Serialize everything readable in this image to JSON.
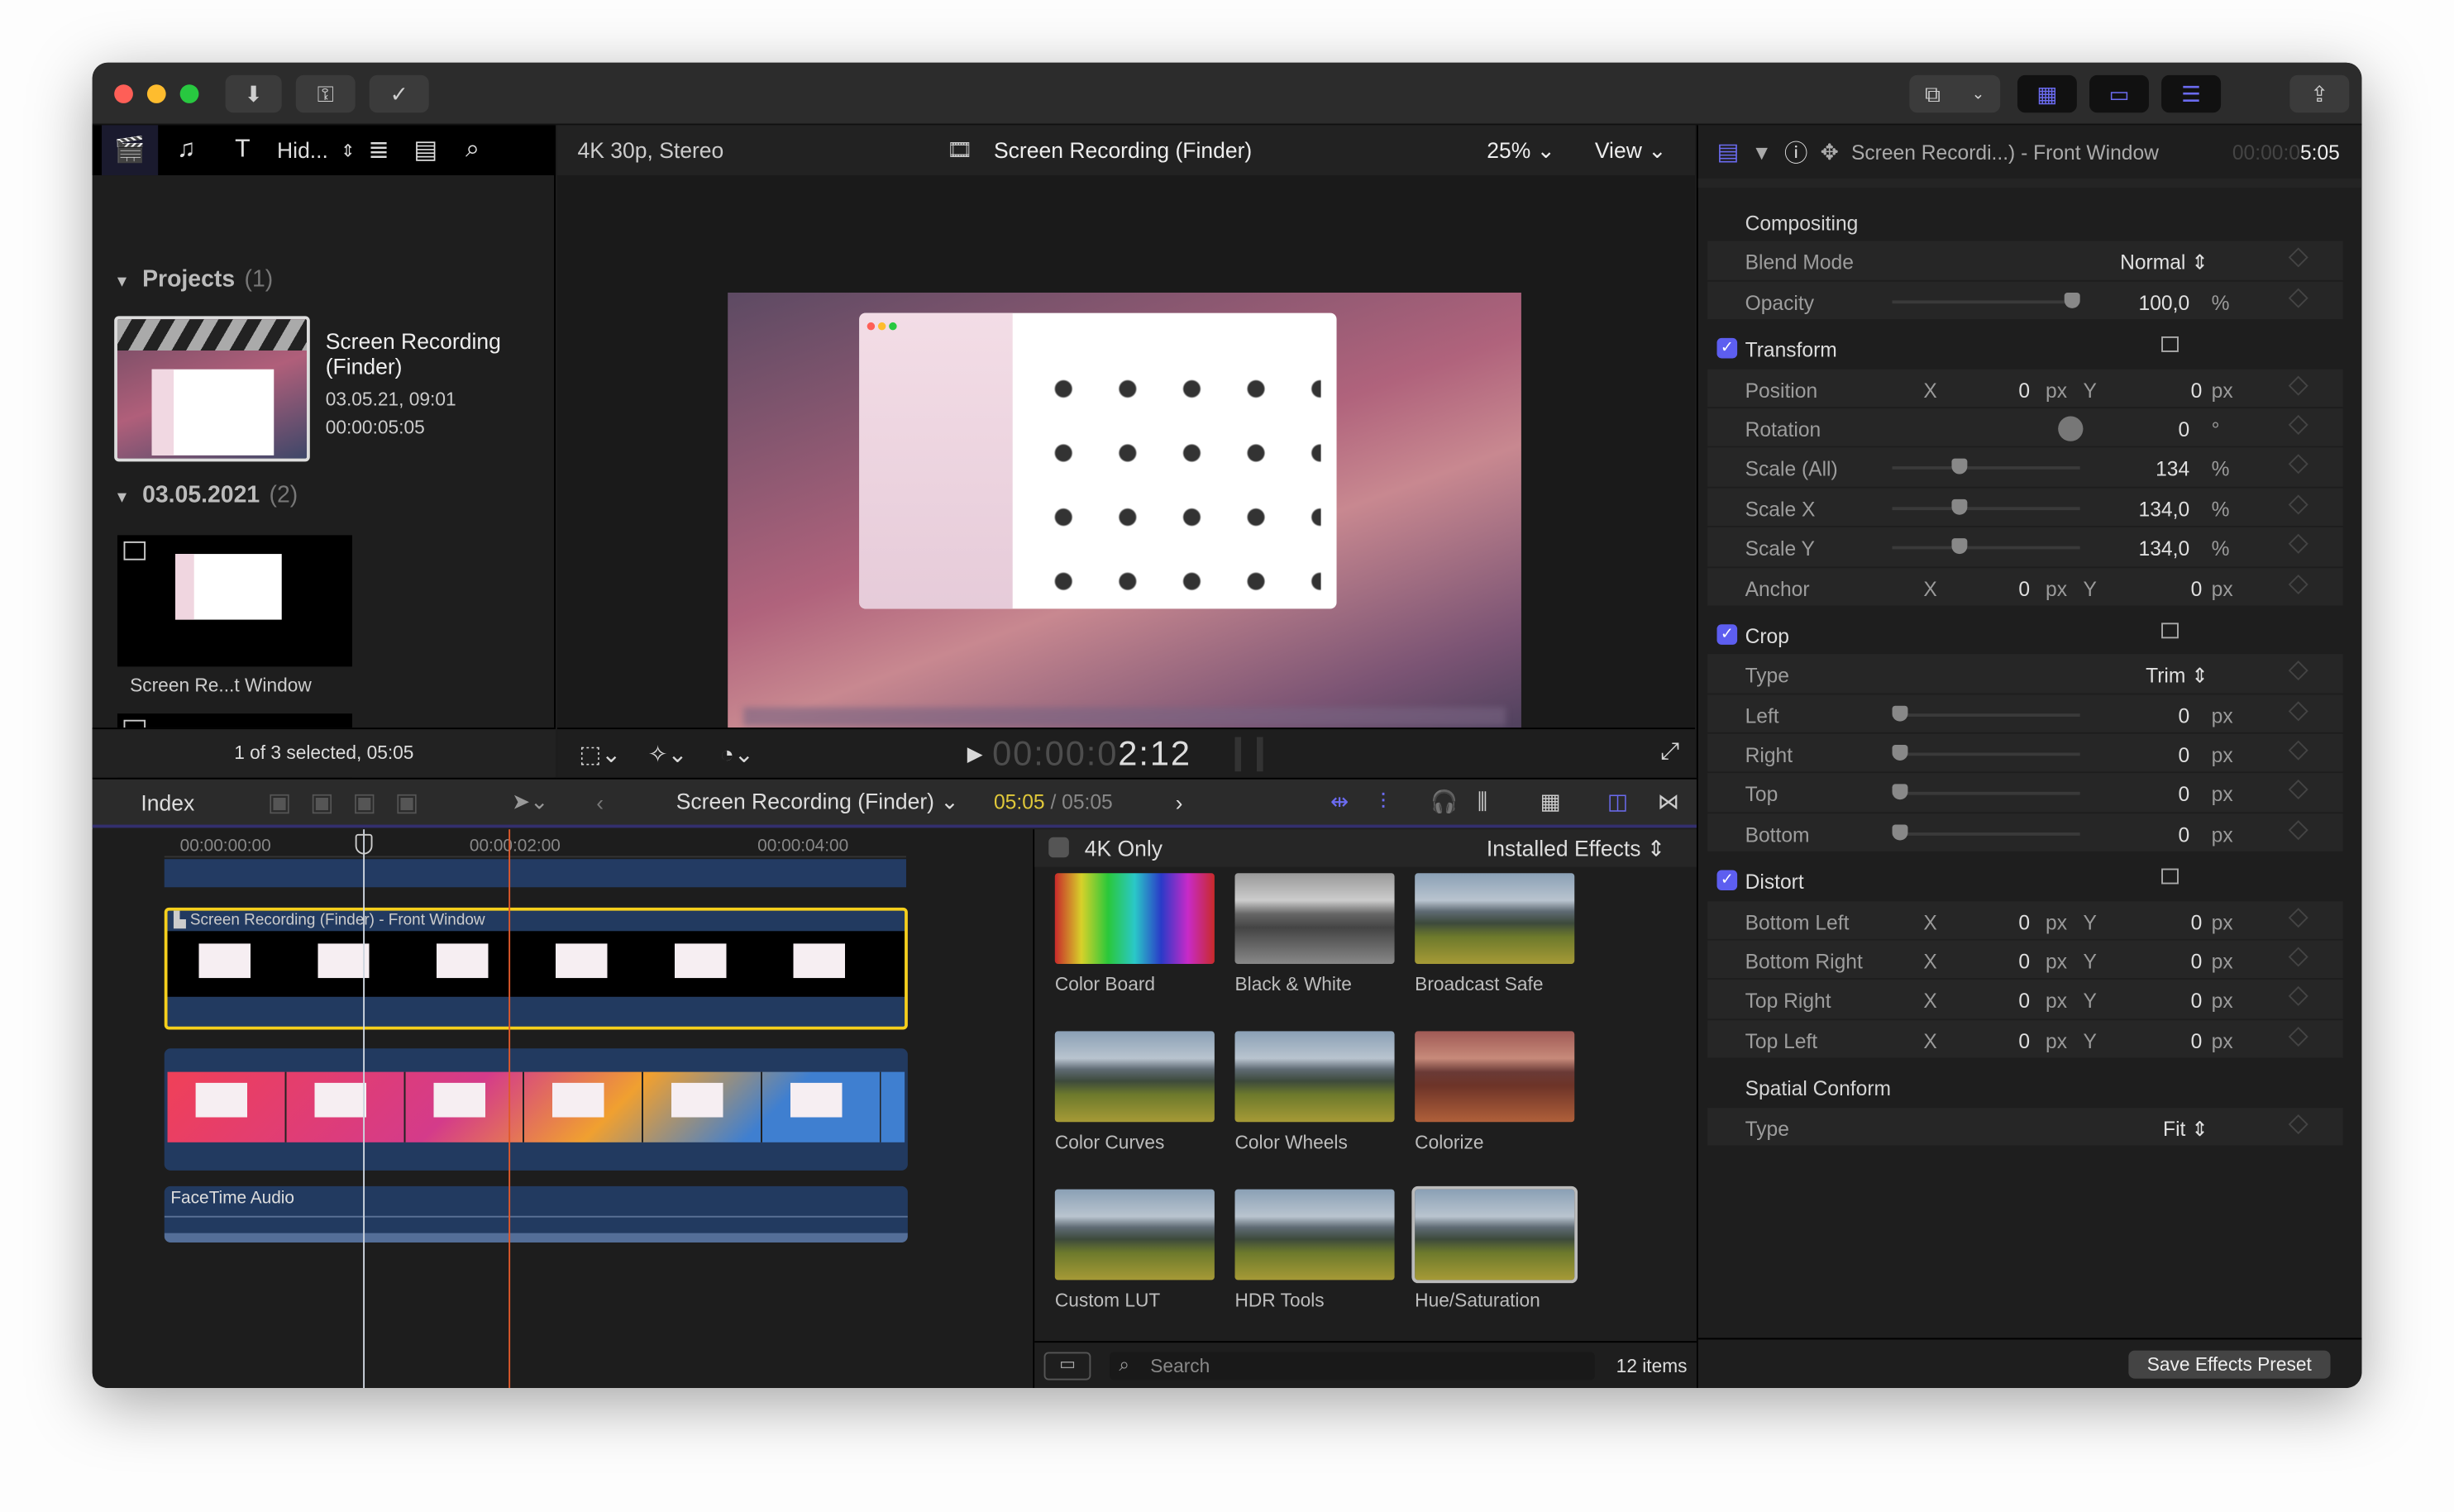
{
  "titlebar": {
    "buttons": [
      "import-icon",
      "keywords-icon",
      "background-tasks-icon"
    ],
    "right_buttons": [
      "workspace-icon",
      "chevron-down-icon",
      "browser-toggle-icon",
      "timeline-toggle-icon",
      "inspector-toggle-icon",
      "share-icon"
    ],
    "accent": "#6b6bf0"
  },
  "browser": {
    "filter_label": "Hid...",
    "projects": {
      "label": "Projects",
      "count": "(1)"
    },
    "project": {
      "name": "Screen Recording (Finder)",
      "date": "03.05.21, 09:01",
      "duration": "00:00:05:05"
    },
    "event": {
      "label": "03.05.2021",
      "count": "(2)"
    },
    "clip_name": "Screen Re...t Window",
    "status": "1 of 3 selected, 05:05"
  },
  "viewer": {
    "format": "4K 30p, Stereo",
    "title": "Screen Recording (Finder)",
    "zoom": "25%",
    "view_label": "View",
    "timecode_dim": "00:00:0",
    "timecode": "2:12"
  },
  "inspector": {
    "title": "Screen Recordi...) - Front Window",
    "time_dim": "00:00:0",
    "time": "5:05",
    "rows": [
      {
        "type": "head",
        "label": "Compositing"
      },
      {
        "type": "popup",
        "label": "Blend Mode",
        "value": "Normal"
      },
      {
        "type": "slider",
        "label": "Opacity",
        "value": "100,0",
        "unit": "%",
        "level": 0.98
      },
      {
        "type": "check",
        "label": "Transform"
      },
      {
        "type": "xy",
        "label": "Position",
        "x": "0",
        "y": "0",
        "unit": "px"
      },
      {
        "type": "dial",
        "label": "Rotation",
        "value": "0",
        "unit": "°"
      },
      {
        "type": "slider",
        "label": "Scale (All)",
        "value": "134",
        "unit": "%",
        "level": 0.34
      },
      {
        "type": "slider",
        "label": "Scale X",
        "value": "134,0",
        "unit": "%",
        "level": 0.34
      },
      {
        "type": "slider",
        "label": "Scale Y",
        "value": "134,0",
        "unit": "%",
        "level": 0.34
      },
      {
        "type": "xy",
        "label": "Anchor",
        "x": "0",
        "y": "0",
        "unit": "px"
      },
      {
        "type": "check",
        "label": "Crop"
      },
      {
        "type": "popup",
        "label": "Type",
        "value": "Trim"
      },
      {
        "type": "slider",
        "label": "Left",
        "value": "0",
        "unit": "px",
        "level": 0
      },
      {
        "type": "slider",
        "label": "Right",
        "value": "0",
        "unit": "px",
        "level": 0
      },
      {
        "type": "slider",
        "label": "Top",
        "value": "0",
        "unit": "px",
        "level": 0
      },
      {
        "type": "slider",
        "label": "Bottom",
        "value": "0",
        "unit": "px",
        "level": 0
      },
      {
        "type": "check",
        "label": "Distort"
      },
      {
        "type": "xy",
        "label": "Bottom Left",
        "x": "0",
        "y": "0",
        "unit": "px"
      },
      {
        "type": "xy",
        "label": "Bottom Right",
        "x": "0",
        "y": "0",
        "unit": "px"
      },
      {
        "type": "xy",
        "label": "Top Right",
        "x": "0",
        "y": "0",
        "unit": "px"
      },
      {
        "type": "xy",
        "label": "Top Left",
        "x": "0",
        "y": "0",
        "unit": "px"
      },
      {
        "type": "head",
        "label": "Spatial Conform"
      },
      {
        "type": "popup",
        "label": "Type",
        "value": "Fit"
      }
    ],
    "x_label": "X",
    "y_label": "Y",
    "save_preset": "Save Effects Preset"
  },
  "timeline": {
    "index_label": "Index",
    "project": "Screen Recording (Finder)",
    "position": "05:05",
    "duration": "/ 05:05",
    "ticks": [
      "00:00:00:00",
      "00:00:02:00",
      "00:00:04:00"
    ],
    "clip_title": "Screen Recording (Finder) - Front Window",
    "audio_title": "FaceTime Audio",
    "selection_color": "#f5cf1c",
    "playhead_color": "#e0592a"
  },
  "effects": {
    "filter_label": "4K Only",
    "category": "Installed Effects",
    "items": [
      {
        "name": "Color Board",
        "style": "rainbow"
      },
      {
        "name": "Black & White",
        "style": "bw"
      },
      {
        "name": "Broadcast Safe",
        "style": "land"
      },
      {
        "name": "Color Curves",
        "style": "land"
      },
      {
        "name": "Color Wheels",
        "style": "land"
      },
      {
        "name": "Colorize",
        "style": "red"
      },
      {
        "name": "Custom LUT",
        "style": "land"
      },
      {
        "name": "HDR Tools",
        "style": "land"
      },
      {
        "name": "Hue/Saturation",
        "style": "land"
      }
    ],
    "search_placeholder": "Search",
    "count": "12 items"
  }
}
